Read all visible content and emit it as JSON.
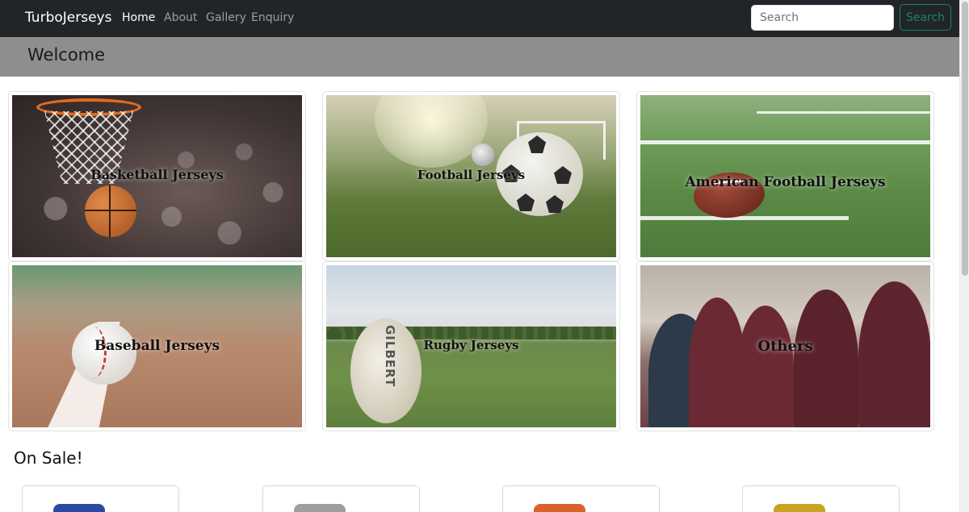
{
  "navbar": {
    "brand": "TurboJerseys",
    "links": [
      {
        "label": "Home",
        "active": true
      },
      {
        "label": "About",
        "active": false
      },
      {
        "label": "Gallery",
        "active": false
      },
      {
        "label": "Enquiry",
        "active": false
      }
    ],
    "search": {
      "placeholder": "Search",
      "button_label": "Search"
    }
  },
  "welcome": {
    "title": "Welcome"
  },
  "categories": [
    {
      "label": "Basketball Jerseys"
    },
    {
      "label": "Football Jerseys"
    },
    {
      "label": "American Football Jerseys"
    },
    {
      "label": "Baseball Jerseys"
    },
    {
      "label": "Rugby Jerseys"
    },
    {
      "label": "Others"
    }
  ],
  "on_sale": {
    "title": "On Sale!",
    "products": [
      {
        "name": "",
        "color": "#2b4aa6"
      },
      {
        "name": "",
        "color": "#9e9e9e"
      },
      {
        "name": "",
        "color": "#d9622b"
      },
      {
        "name": "",
        "color": "#c8a423"
      }
    ]
  },
  "colors": {
    "navbar_bg": "#212529",
    "welcome_bg": "#8e8e8e",
    "search_btn": "#198754"
  }
}
